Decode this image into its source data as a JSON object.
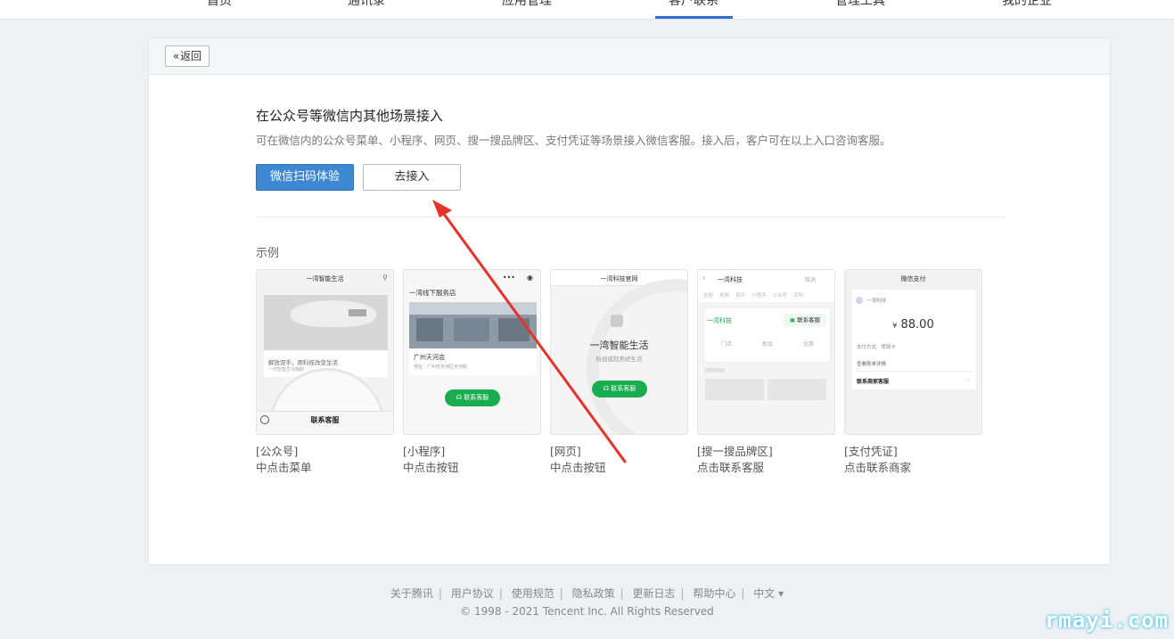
{
  "nav": {
    "items": [
      "首页",
      "通讯录",
      "应用管理",
      "客户联系",
      "管理工具",
      "我的企业"
    ],
    "active_index": 3
  },
  "back_label": "返回",
  "title": "在公众号等微信内其他场景接入",
  "subtitle": "可在微信内的公众号菜单、小程序、网页、搜一搜品牌区、支付凭证等场景接入微信客服。接入后，客户可在以上入口咨询客服。",
  "buttons": {
    "primary": "微信扫码体验",
    "secondary": "去接入"
  },
  "example_label": "示例",
  "examples": [
    {
      "cap1": "[公众号]",
      "cap2": "中点击菜单",
      "mock": {
        "title": "一湾智能生活",
        "text1": "解放双手，用科技改变生活",
        "text2": "一湾智能生活旗舰",
        "button": "联系客服"
      }
    },
    {
      "cap1": "[小程序]",
      "cap2": "中点击按钮",
      "mock": {
        "title": "一湾线下服务店",
        "store": "广州天河店",
        "addr": "地址：广州市天河区天河街",
        "button": "联系客服"
      }
    },
    {
      "cap1": "[网页]",
      "cap2": "中点击按钮",
      "mock": {
        "title": "一湾科技官网",
        "brand": "一湾智能生活",
        "slogan": "科技成就美好生活",
        "button": "联系客服"
      }
    },
    {
      "cap1": "[搜一搜品牌区]",
      "cap2": "点击联系客服",
      "mock": {
        "title": "一湾科技",
        "cancel": "取消",
        "tabs": [
          "全部",
          "视频",
          "资讯",
          "小程序",
          "公众号",
          "百科"
        ],
        "brand": "一湾科技",
        "button": "联系客服",
        "icons": [
          "门店",
          "新品",
          "优惠"
        ]
      }
    },
    {
      "cap1": "[支付凭证]",
      "cap2": "点击联系商家",
      "mock": {
        "title": "微信支付",
        "merchant": "一湾科技",
        "amount": "88.00",
        "currency": "¥",
        "method_label": "支付方式",
        "method": "零钱卡",
        "detail": "查看账单详情",
        "contact": "联系商家客服"
      }
    }
  ],
  "footer": {
    "links": [
      "关于腾讯",
      "用户协议",
      "使用规范",
      "隐私政策",
      "更新日志",
      "帮助中心",
      "中文 ▾"
    ],
    "copyright": "© 1998 - 2021 Tencent Inc. All Rights Reserved"
  },
  "watermark": "rmayi.com",
  "colors": {
    "primary": "#3d87d3",
    "green": "#1aad4f",
    "nav_active": "#2b6dcb",
    "arrow": "#e8312a"
  }
}
